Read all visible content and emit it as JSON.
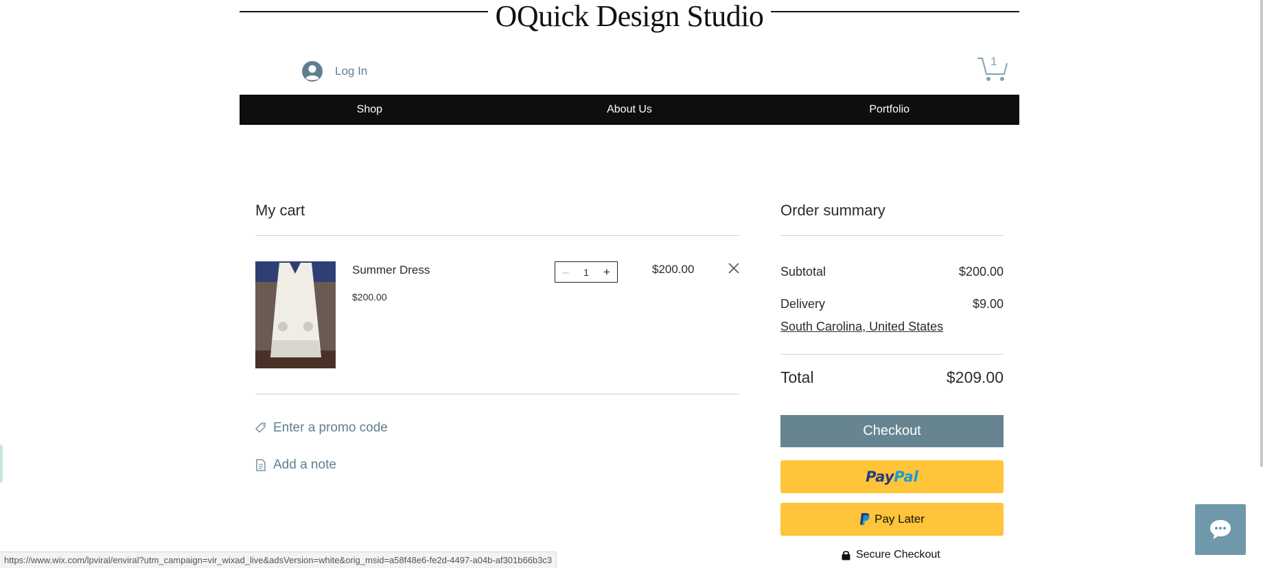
{
  "site": {
    "title": "OQuick Design Studio",
    "login_label": "Log In",
    "cart_count": "1"
  },
  "nav": {
    "items": [
      {
        "label": "Shop"
      },
      {
        "label": "About Us"
      },
      {
        "label": "Portfolio"
      }
    ]
  },
  "cart": {
    "title": "My cart",
    "items": [
      {
        "name": "Summer Dress",
        "unit_price": "$200.00",
        "quantity": "1",
        "line_total": "$200.00",
        "image_icon": "white-dress-photo"
      }
    ],
    "promo_label": "Enter a promo code",
    "note_label": "Add a note"
  },
  "summary": {
    "title": "Order summary",
    "subtotal_label": "Subtotal",
    "subtotal_value": "$200.00",
    "delivery_label": "Delivery",
    "delivery_value": "$9.00",
    "delivery_location": "South Carolina, United States",
    "total_label": "Total",
    "total_value": "$209.00",
    "checkout_label": "Checkout",
    "paypal_pay": "Pay",
    "paypal_pal": "Pal",
    "paylater_label": "Pay Later",
    "secure_label": "Secure Checkout"
  },
  "status_bar": {
    "url": "https://www.wix.com/lpviral/enviral?utm_campaign=vir_wixad_live&adsVersion=white&orig_msid=a58f48e6-fe2d-4497-a04b-af301b66b3c3"
  },
  "colors": {
    "accent": "#678591",
    "link": "#5f7f8f",
    "nav_bg": "#0e0e0e",
    "paypal_yellow": "#ffc439",
    "chat_bg": "#6f99ab"
  }
}
